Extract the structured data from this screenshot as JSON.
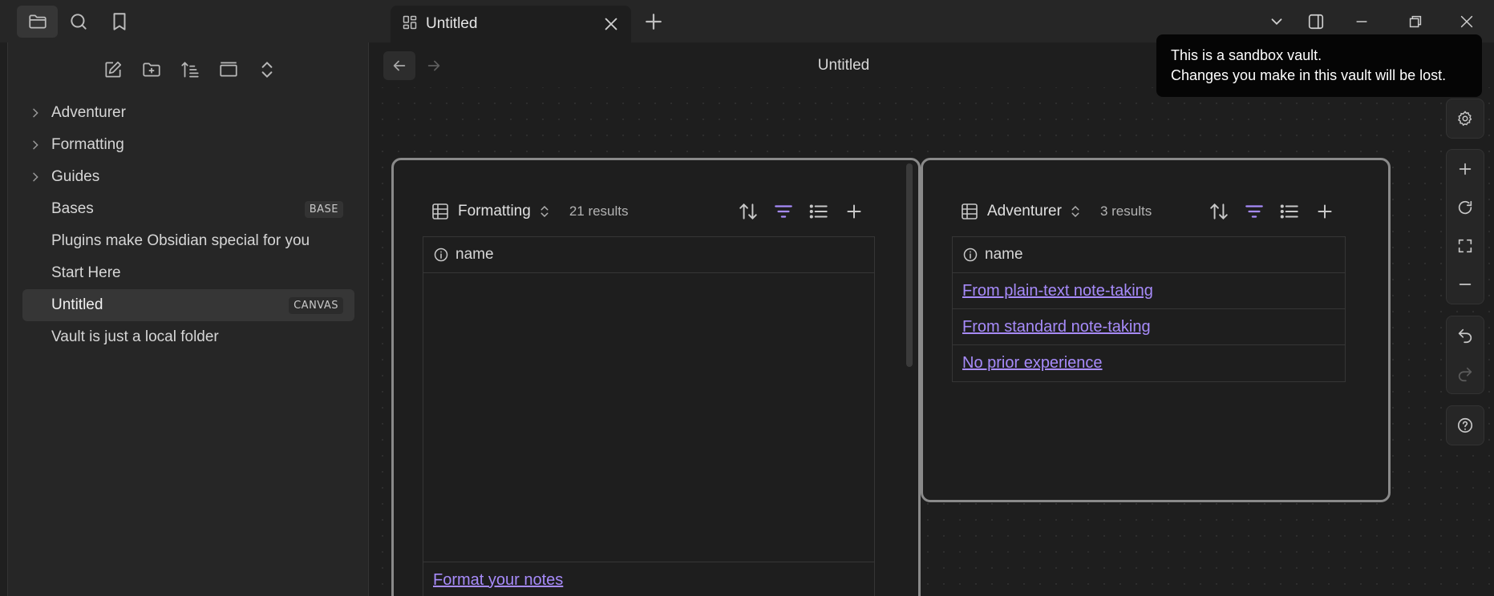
{
  "tab": {
    "title": "Untitled"
  },
  "sidebar": {
    "items": [
      {
        "label": "Adventurer",
        "folder": true,
        "badge": ""
      },
      {
        "label": "Formatting",
        "folder": true,
        "badge": ""
      },
      {
        "label": "Guides",
        "folder": true,
        "badge": ""
      },
      {
        "label": "Bases",
        "folder": false,
        "badge": "BASE"
      },
      {
        "label": "Plugins make Obsidian special for you",
        "folder": false,
        "badge": ""
      },
      {
        "label": "Start Here",
        "folder": false,
        "badge": ""
      },
      {
        "label": "Untitled",
        "folder": false,
        "badge": "CANVAS",
        "active": true
      },
      {
        "label": "Vault is just a local folder",
        "folder": false,
        "badge": ""
      }
    ]
  },
  "view": {
    "title": "Untitled"
  },
  "tooltip": {
    "line1": "This is a sandbox vault.",
    "line2": "Changes you make in this vault will be lost."
  },
  "cards": [
    {
      "view_name": "Formatting",
      "count": "21 results",
      "column": "name",
      "rows": [],
      "footer_link": "Format your notes"
    },
    {
      "view_name": "Adventurer",
      "count": "3 results",
      "column": "name",
      "rows": [
        "From plain-text note-taking",
        "From standard note-taking",
        "No prior experience"
      ]
    }
  ],
  "colors": {
    "accent": "#a78bfa",
    "background": "#1e1e1e",
    "sidebar": "#262626"
  }
}
